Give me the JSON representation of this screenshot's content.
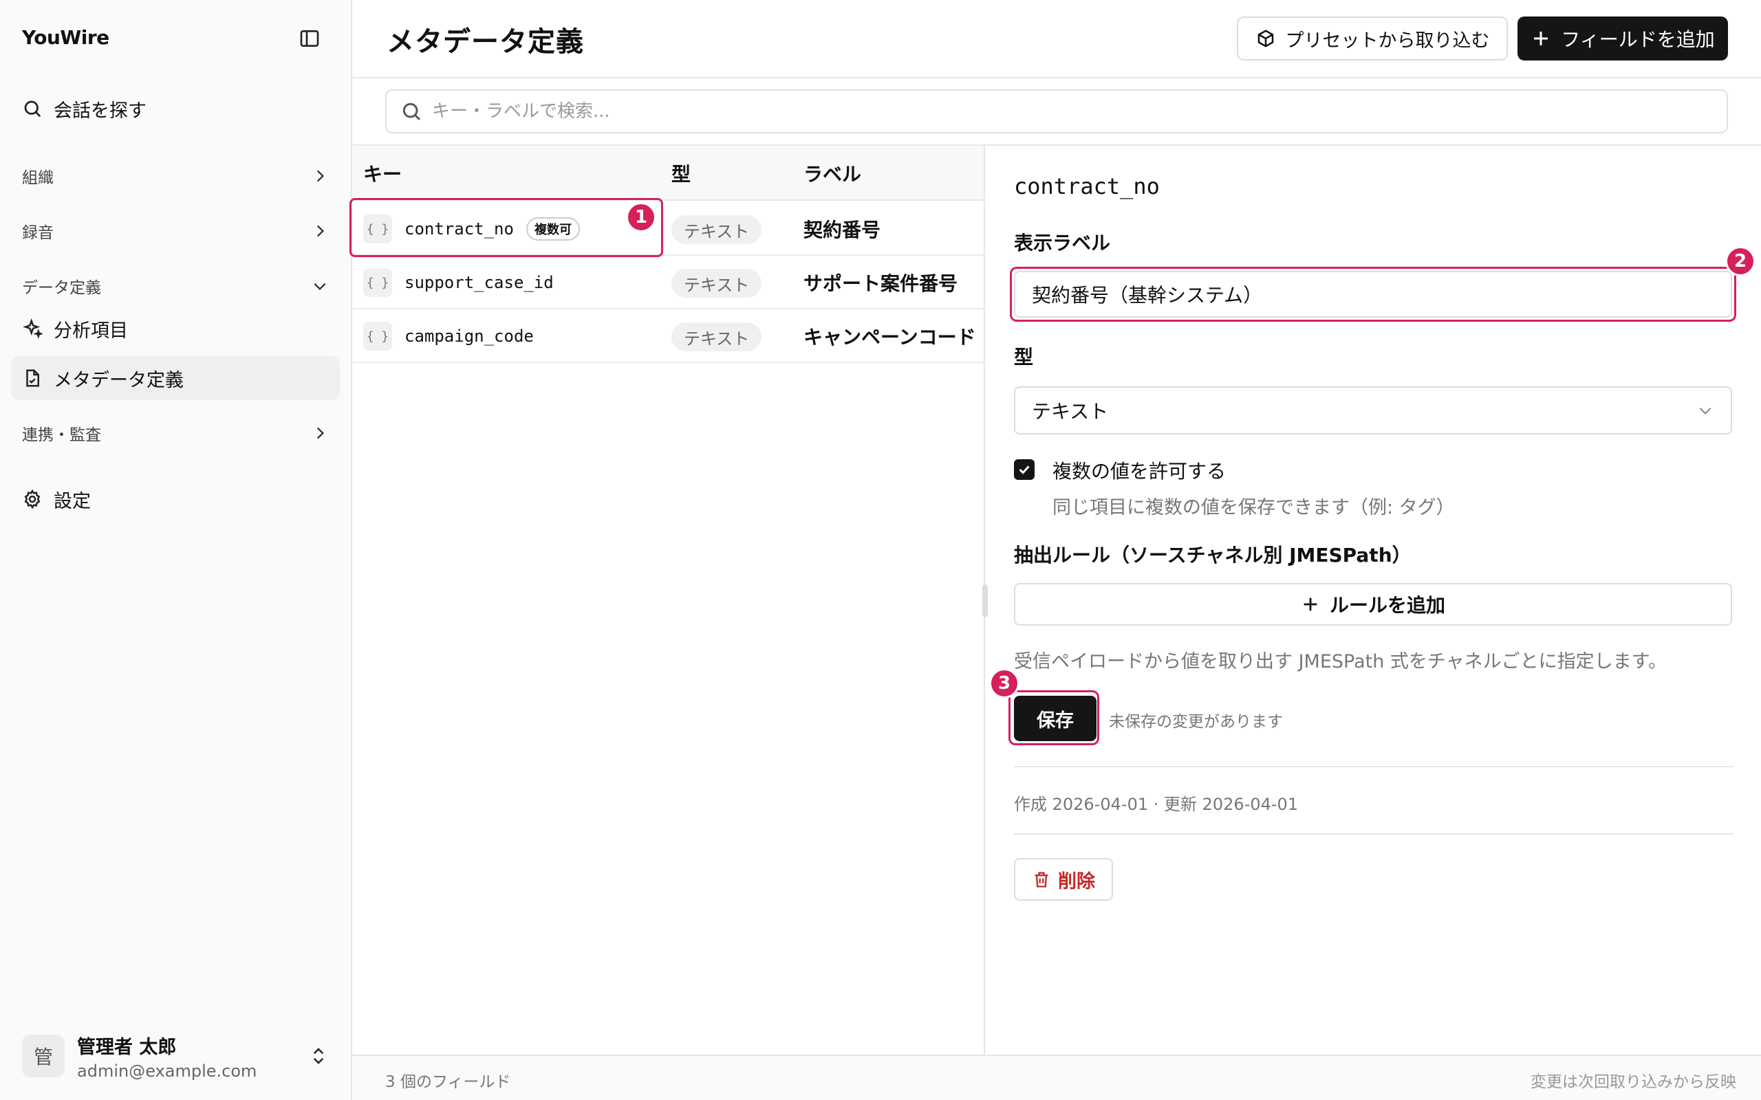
{
  "app": {
    "brand": "YouWire"
  },
  "sidebar": {
    "search_label": "会話を探す",
    "sections": [
      {
        "label": "組織"
      },
      {
        "label": "録音"
      },
      {
        "label": "データ定義"
      }
    ],
    "items": [
      {
        "label": "分析項目",
        "icon": "sparkle-icon"
      },
      {
        "label": "メタデータ定義",
        "icon": "document-icon"
      }
    ],
    "integration_label": "連携・監査",
    "settings_label": "設定",
    "user": {
      "avatar": "管",
      "name": "管理者 太郎",
      "email": "admin@example.com"
    }
  },
  "header": {
    "title": "メタデータ定義",
    "import_label": "プリセットから取り込む",
    "add_field_label": "フィールドを追加"
  },
  "search": {
    "placeholder": "キー・ラベルで検索..."
  },
  "table": {
    "columns": [
      "キー",
      "型",
      "ラベル"
    ],
    "rows": [
      {
        "key": "contract_no",
        "badge": "複数可",
        "type": "テキスト",
        "label": "契約番号"
      },
      {
        "key": "support_case_id",
        "type": "テキスト",
        "label": "サポート案件番号"
      },
      {
        "key": "campaign_code",
        "type": "テキスト",
        "label": "キャンペーンコード"
      }
    ],
    "brace_glyph": "{ }"
  },
  "detail": {
    "key": "contract_no",
    "display_label_title": "表示ラベル",
    "display_label_value": "契約番号（基幹システム）",
    "type_title": "型",
    "type_value": "テキスト",
    "multi_label": "複数の値を許可する",
    "multi_help": "同じ項目に複数の値を保存できます（例: タグ）",
    "multi_checked": true,
    "rules_title": "抽出ルール（ソースチャネル別 JMESPath）",
    "add_rule_label": "ルールを追加",
    "rules_help": "受信ペイロードから値を取り出す JMESPath 式をチャネルごとに指定します。",
    "save_label": "保存",
    "unsaved_label": "未保存の変更があります",
    "meta": "作成 2026-04-01 · 更新 2026-04-01",
    "delete_label": "削除"
  },
  "annotations": [
    "1",
    "2",
    "3"
  ],
  "footer": {
    "count": "3 個のフィールド",
    "note": "変更は次回取り込みから反映"
  },
  "colors": {
    "accent": "#d6205a",
    "primary": "#151515",
    "danger": "#c62828"
  }
}
